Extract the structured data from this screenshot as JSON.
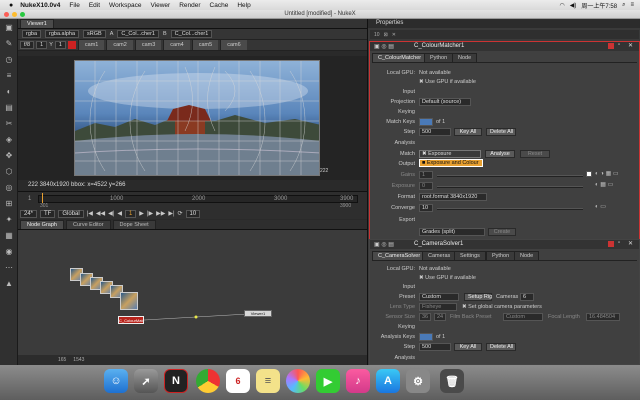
{
  "menubar": {
    "apple": "",
    "app_name": "NukeX10.0v4",
    "items": [
      "File",
      "Edit",
      "Workspace",
      "Viewer",
      "Render",
      "Cache",
      "Help"
    ],
    "clock": "周一上午7:58"
  },
  "window_title": "Untitled [modified] - NukeX",
  "viewer": {
    "tab": "Viewer1",
    "channels": "rgba",
    "layer": "rgba.alpha",
    "colorspace": "sRGB",
    "input_a": "A",
    "input_a_node": "C_Col...cher1",
    "input_b": "B",
    "input_b_node": "C_Col...cher1",
    "cam_tabs": [
      "cam1",
      "cam2",
      "cam3",
      "cam4",
      "cam5",
      "cam6"
    ],
    "zoom": "f/8",
    "scale": "1",
    "y_label": "Y",
    "gain_label": "1",
    "format_info": "222 3840x1920  bbox: x=4522 y=266",
    "corner_label": "222",
    "timeline_marks": [
      "1",
      "1000",
      "2000",
      "3000",
      "3900"
    ],
    "frame_start": "301",
    "frame_end": "3900",
    "fps": "24*",
    "tf": "TF",
    "global": "Global",
    "current_frame": "1",
    "increment": "10"
  },
  "nodegraph": {
    "tabs": [
      "Node Graph",
      "Curve Editor",
      "Dope Sheet"
    ],
    "viewer_node_label": "Viewer1",
    "source_node_label": "C_ColourMatcher1",
    "status_numbers": [
      "165",
      "1543"
    ]
  },
  "properties": {
    "title": "Properties",
    "colourmatcher": {
      "node_name": "C_ColourMatcher1",
      "tabs": [
        "C_ColourMatcher",
        "Python",
        "Node"
      ],
      "local_gpu_label": "Local GPU:",
      "local_gpu_value": "Not available",
      "use_gpu": "Use GPU if available",
      "input_section": "Input",
      "projection_label": "Projection",
      "projection_value": "Default (source)",
      "keying_section": "Keying",
      "match_keys_label": "Match Keys",
      "match_keys_of": "of 1",
      "step_label": "Step",
      "step_value": "500",
      "key_all": "Key All",
      "delete_all": "Delete All",
      "analysis_section": "Analysis",
      "match_label": "Match",
      "match_value": "Exposure",
      "match_option_2": "Exposure and Colour",
      "analyse_btn": "Analyse",
      "reset_btn": "Reset",
      "output_label": "Output",
      "gains_label": "Gains",
      "gains_value": "1",
      "exposure_label": "Exposure",
      "exposure_value": "0",
      "format_label": "Format",
      "format_value": "root.format 3840x1920",
      "converge_label": "Converge",
      "converge_value": "10",
      "export_section": "Export",
      "export_value": "Grades (split)",
      "create_btn": "Create"
    },
    "camerasolver": {
      "node_name": "C_CameraSolver1",
      "tabs": [
        "C_CameraSolver",
        "Cameras",
        "Settings",
        "Python",
        "Node"
      ],
      "local_gpu_label": "Local GPU:",
      "local_gpu_value": "Not available",
      "use_gpu": "Use GPU if available",
      "input_section": "Input",
      "preset_label": "Preset",
      "preset_value": "Custom",
      "setup_rig_btn": "Setup Rig",
      "cameras_label": "Cameras",
      "cameras_value": "6",
      "lens_type_label": "Lens Type",
      "lens_type_value": "Fisheye",
      "set_global": "Set global camera parameters",
      "sensor_size_label": "Sensor Size",
      "sensor_w": "36",
      "sensor_h": "24",
      "film_back_label": "Film Back Preset",
      "film_back_value": "Custom",
      "focal_length_label": "Focal Length",
      "focal_length_value": "16.484504",
      "keying_section": "Keying",
      "analysis_keys_label": "Analysis Keys",
      "analysis_keys_of": "of 1",
      "step_label": "Step",
      "step_value": "500",
      "key_all": "Key All",
      "delete_all": "Delete All",
      "analysis_section": "Analysis"
    }
  },
  "dock": {
    "calendar_day": "6"
  }
}
